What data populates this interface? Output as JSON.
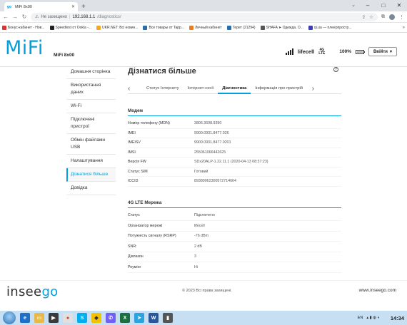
{
  "browser": {
    "tab_title": "MiFi 8x00",
    "tab_favicon": "go",
    "not_secure_label": "Не захищено",
    "url_host": "192.168.1.1",
    "url_path": "/diagnostics/"
  },
  "bookmarks": [
    {
      "label": "Бонус-кабинет - Нов...",
      "icon": "bonus-icon",
      "color": "#d33"
    },
    {
      "label": "Speedtest от Ookla -...",
      "icon": "speedtest-icon",
      "color": "#222"
    },
    {
      "label": "UKR.NET: Всі новин...",
      "icon": "ukrnet-icon",
      "color": "#f5a623"
    },
    {
      "label": "Все товары от Tapp...",
      "icon": "tapp-icon",
      "color": "#2b6cb0"
    },
    {
      "label": "Личный кабинет",
      "icon": "cabinet-icon",
      "color": "#e67e22"
    },
    {
      "label": "Терет (21294)",
      "icon": "teret-icon",
      "color": "#1d6fb8"
    },
    {
      "label": "SHAFA ➤ Одежда, О...",
      "icon": "shafa-icon",
      "color": "#555"
    },
    {
      "label": "qi.ua — плеерпростр...",
      "icon": "qi-icon",
      "color": "#3d3db5"
    }
  ],
  "header": {
    "logo": "MiFi",
    "model": "MiFi 8x00",
    "carrier": "lifecell",
    "network_top": "4G",
    "network_bottom": "LTE",
    "battery_pct": "100%",
    "battery_level": 1.0,
    "signal_bars": 4,
    "login_label": "Ввійти"
  },
  "sidebar": {
    "items": [
      {
        "label": "Домашня сторінка"
      },
      {
        "label": "Використання даних"
      },
      {
        "label": "Wi-Fi"
      },
      {
        "label": "Підключені пристрої"
      },
      {
        "label": "Обмін файлами USB"
      },
      {
        "label": "Налаштування"
      },
      {
        "label": "Дізнатися більше"
      },
      {
        "label": "Довідка"
      }
    ]
  },
  "main": {
    "title": "Дізнатися більше",
    "help_glyph": "?",
    "tabs": [
      {
        "label": "Статус Інтернету"
      },
      {
        "label": "Інтернет-сесії"
      },
      {
        "label": "Діагностика"
      },
      {
        "label": "Інформація про пристрій"
      }
    ],
    "modem": {
      "title": "Модем",
      "rows": [
        {
          "k": "Номер телефону (MDN)",
          "v": "3806.3698.9390"
        },
        {
          "k": "IMEI",
          "v": "9900.0931.8477.026"
        },
        {
          "k": "IMEISV",
          "v": "9900.0931.8477.0201"
        },
        {
          "k": "IMSI",
          "v": "255061066442625"
        },
        {
          "k": "Версія FW",
          "v": "SDx20ALP-1.22.11.1 (2020-04-13 08:37:23)"
        },
        {
          "k": "Статус SIM",
          "v": "Готовий"
        },
        {
          "k": "ICCID",
          "v": "89380062300572714664"
        }
      ]
    },
    "lte": {
      "title": "4G LTE Мережа",
      "rows": [
        {
          "k": "Статус",
          "v": "Підключено"
        },
        {
          "k": "Організатор мережі",
          "v": "lifecell"
        },
        {
          "k": "Потужність сигналу (RSRP)",
          "v": "-76 dBm"
        },
        {
          "k": "SNR:",
          "v": "2 dB"
        },
        {
          "k": "Діапазон",
          "v": "3"
        },
        {
          "k": "Роумінг",
          "v": "Ні"
        }
      ]
    }
  },
  "footer": {
    "brand_a": "insee",
    "brand_b": "go",
    "copyright": "© 2023 Всі права захищені.",
    "site": "www.inseego.com"
  },
  "taskbar": {
    "lang": "EN",
    "time": "14:34"
  }
}
